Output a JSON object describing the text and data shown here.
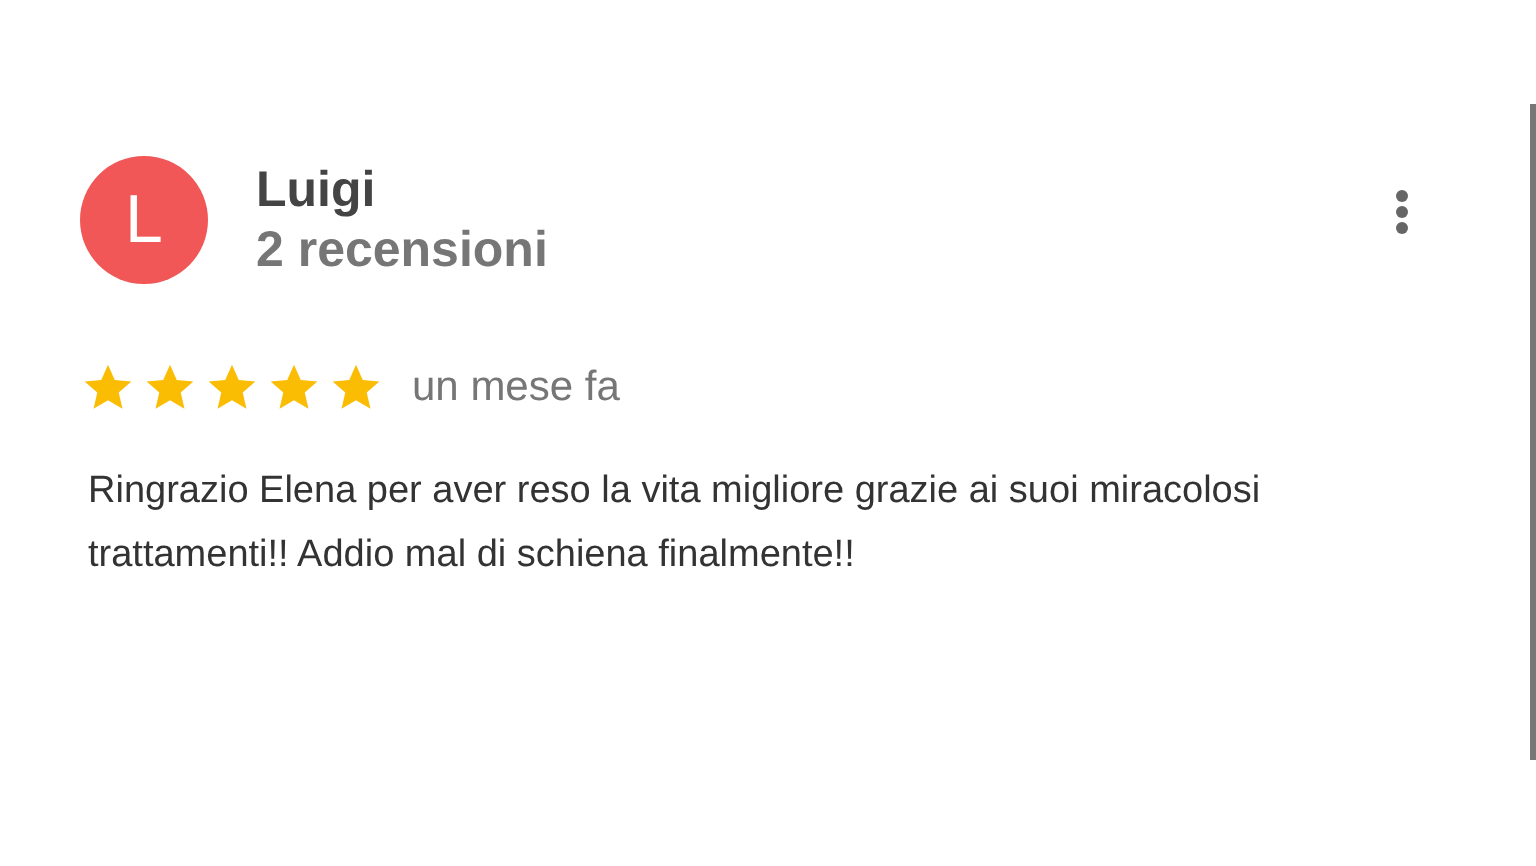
{
  "review": {
    "avatar_letter": "L",
    "author": "Luigi",
    "review_count": "2 recensioni",
    "stars": 5,
    "time": "un mese fa",
    "text": "Ringrazio Elena per aver reso la vita migliore grazie ai suoi miracolosi trattamenti!! Addio mal di schiena finalmente!!"
  }
}
